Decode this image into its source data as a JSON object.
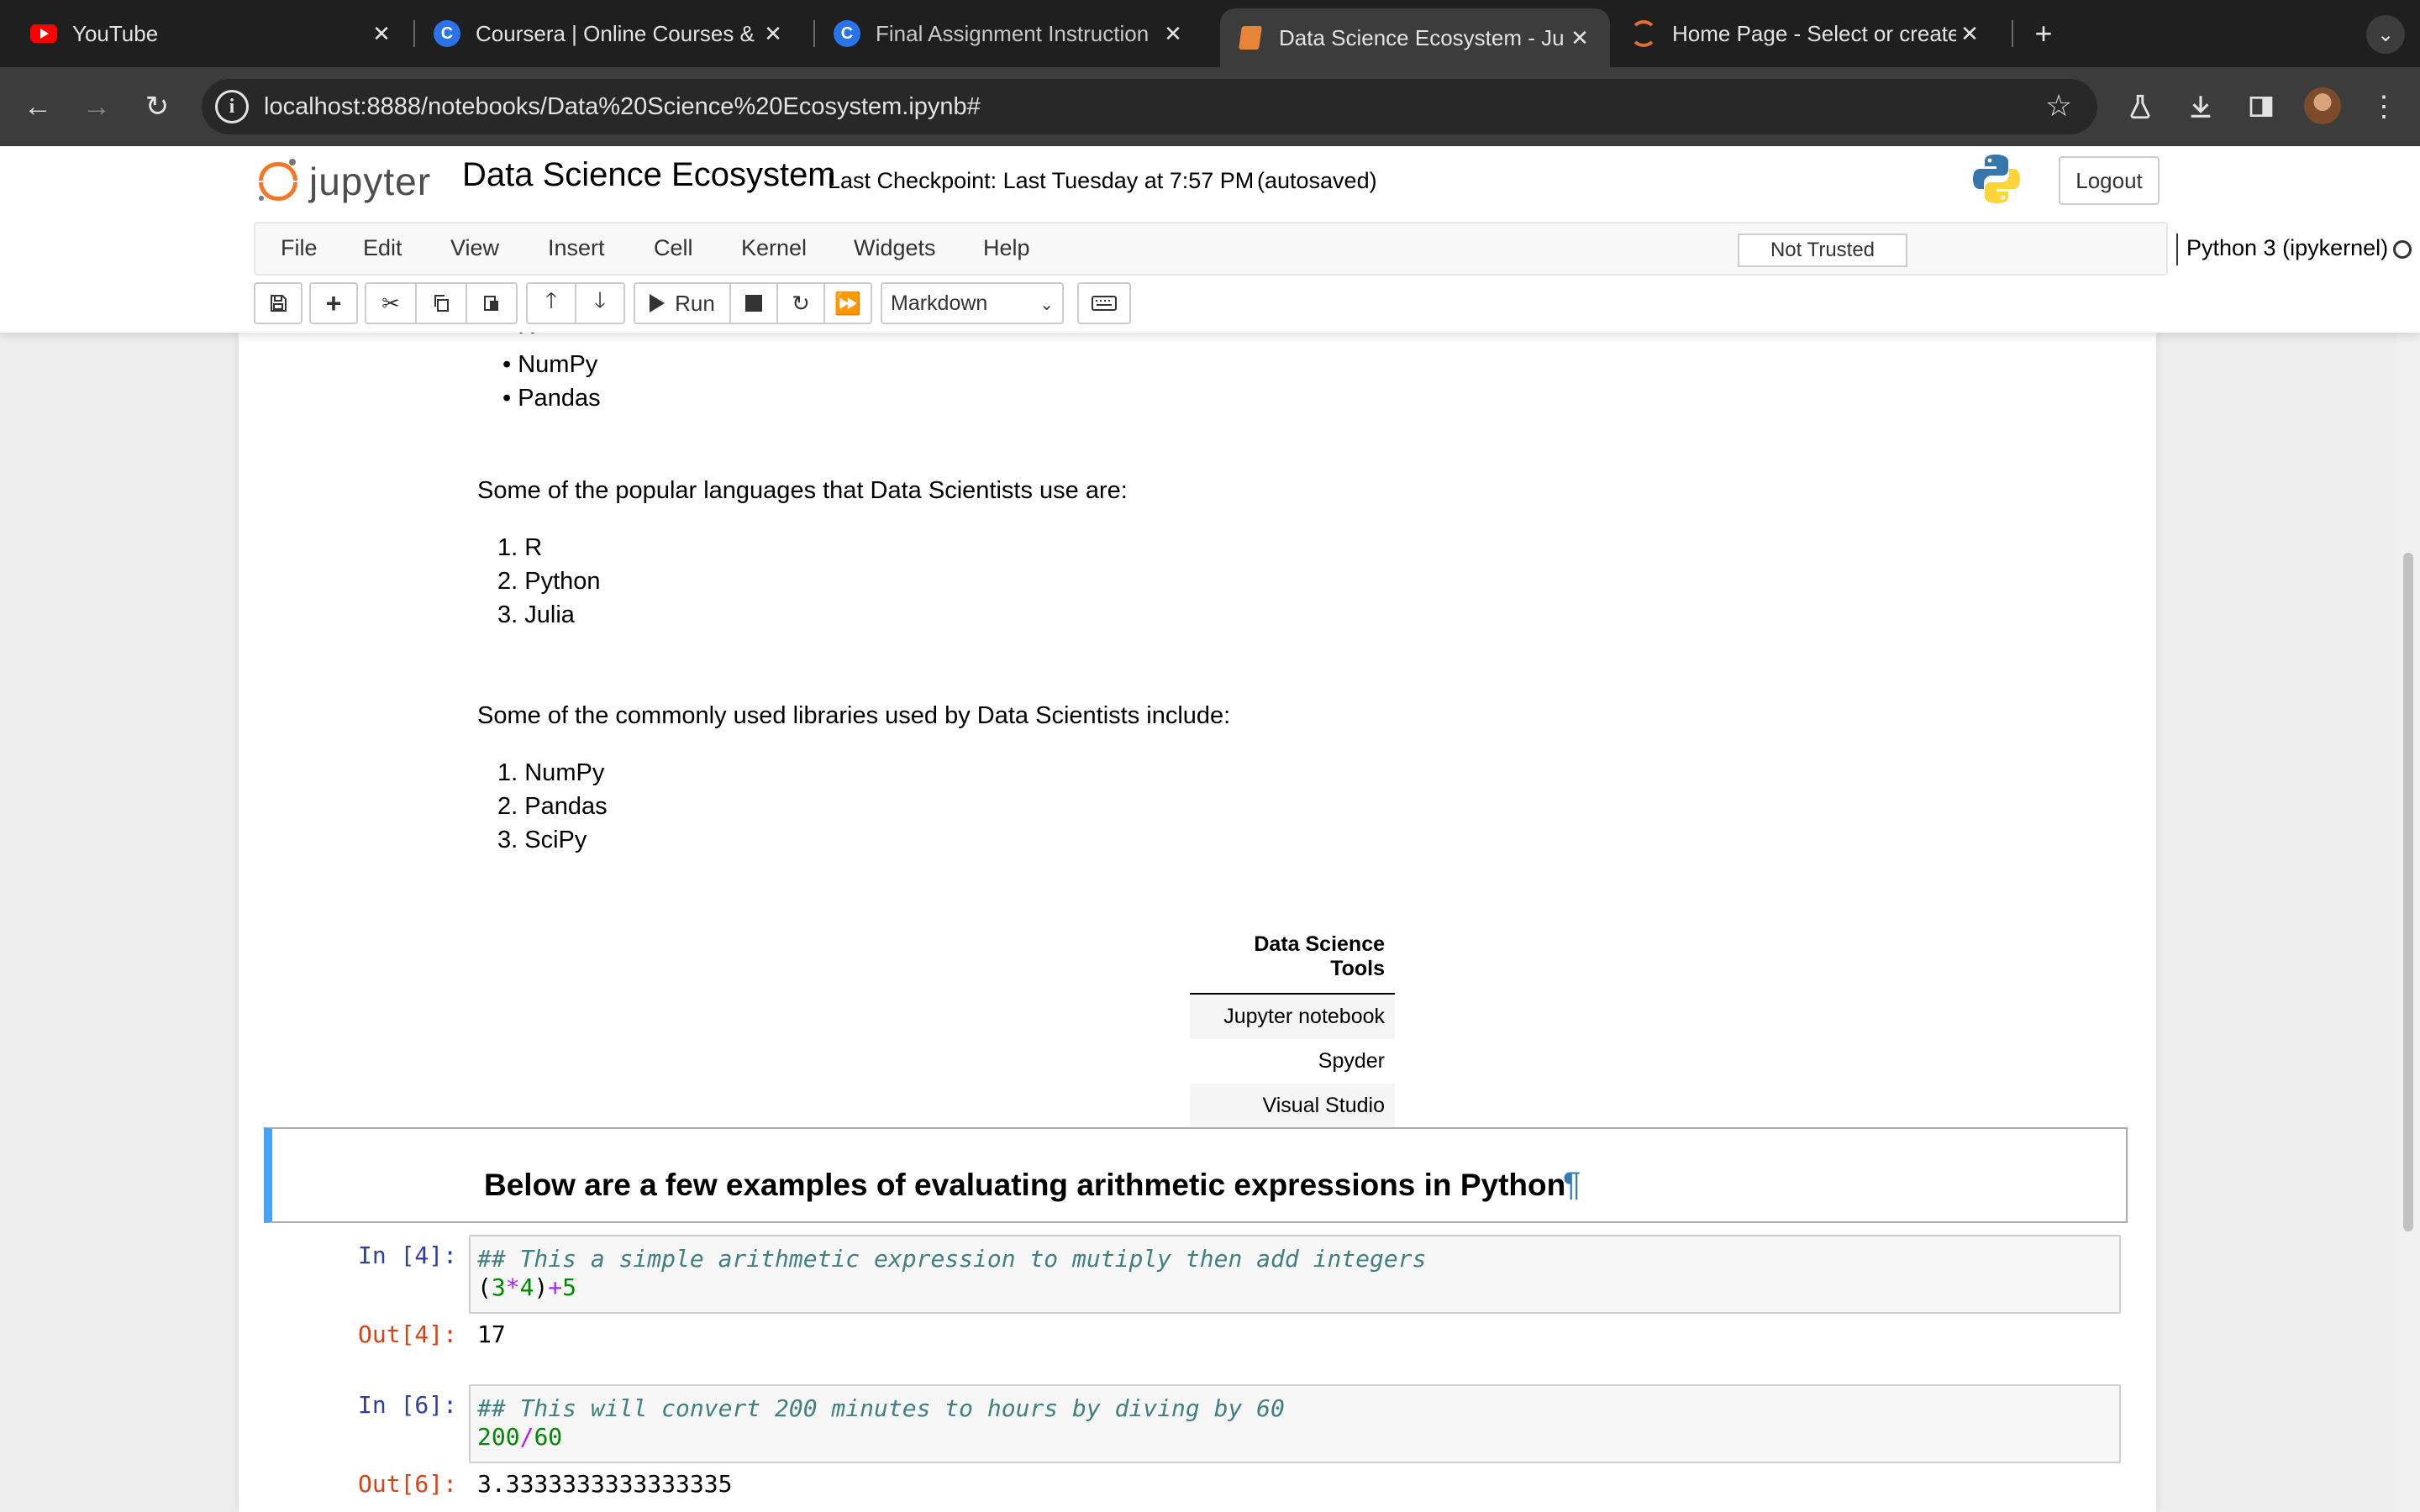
{
  "browser": {
    "tabs": [
      {
        "title": "YouTube",
        "favicon": "youtube-icon"
      },
      {
        "title": "Coursera | Online Courses &",
        "favicon": "coursera-icon"
      },
      {
        "title": "Final Assignment Instruction",
        "favicon": "coursera-icon"
      },
      {
        "title": "Data Science Ecosystem - Ju",
        "favicon": "notebook-icon",
        "active": true
      },
      {
        "title": "Home Page - Select or create",
        "favicon": "jupyter-icon"
      }
    ],
    "url": "localhost:8888/notebooks/Data%20Science%20Ecosystem.ipynb#"
  },
  "jupyter": {
    "logo_text": "jupyter",
    "notebook_name": "Data Science Ecosystem",
    "checkpoint": "Last Checkpoint: Last Tuesday at 7:57 PM",
    "autosave": "(autosaved)",
    "logout_label": "Logout",
    "menu": [
      "File",
      "Edit",
      "View",
      "Insert",
      "Cell",
      "Kernel",
      "Widgets",
      "Help"
    ],
    "trust_label": "Not Trusted",
    "kernel": "Python 3 (ipykernel)",
    "toolbar": {
      "run_label": "Run",
      "cell_type": "Markdown"
    }
  },
  "notebook": {
    "partial_list": [
      "R",
      "NumPy",
      "Pandas"
    ],
    "languages_intro": "Some of the popular languages that Data Scientists use are:",
    "languages": [
      "1. R",
      "2. Python",
      "3. Julia"
    ],
    "libraries_intro": "Some of the commonly used libraries used by Data Scientists include:",
    "libraries": [
      "1. NumPy",
      "2. Pandas",
      "3. SciPy"
    ],
    "tools_table": {
      "header": "Data Science Tools",
      "rows": [
        "Jupyter notebook",
        "Spyder",
        "Visual Studio"
      ]
    },
    "selected_heading": "Below are a few examples of evaluating arithmetic expressions in Python",
    "pilcrow": "¶",
    "cells": [
      {
        "in_prompt": "In [4]:",
        "comment": "## This a simple arithmetic expression to mutiply then add integers",
        "out_prompt": "Out[4]:",
        "output": "17"
      },
      {
        "in_prompt": "In [6]:",
        "comment": "## This will convert 200 minutes to hours by diving by 60",
        "out_prompt": "Out[6]:",
        "output": "3.3333333333333335"
      }
    ]
  },
  "colors": {
    "accent_selected": "#42a5f5",
    "prompt_in": "#303f9f",
    "prompt_out": "#d84315",
    "jupyter_orange": "#f37726"
  }
}
